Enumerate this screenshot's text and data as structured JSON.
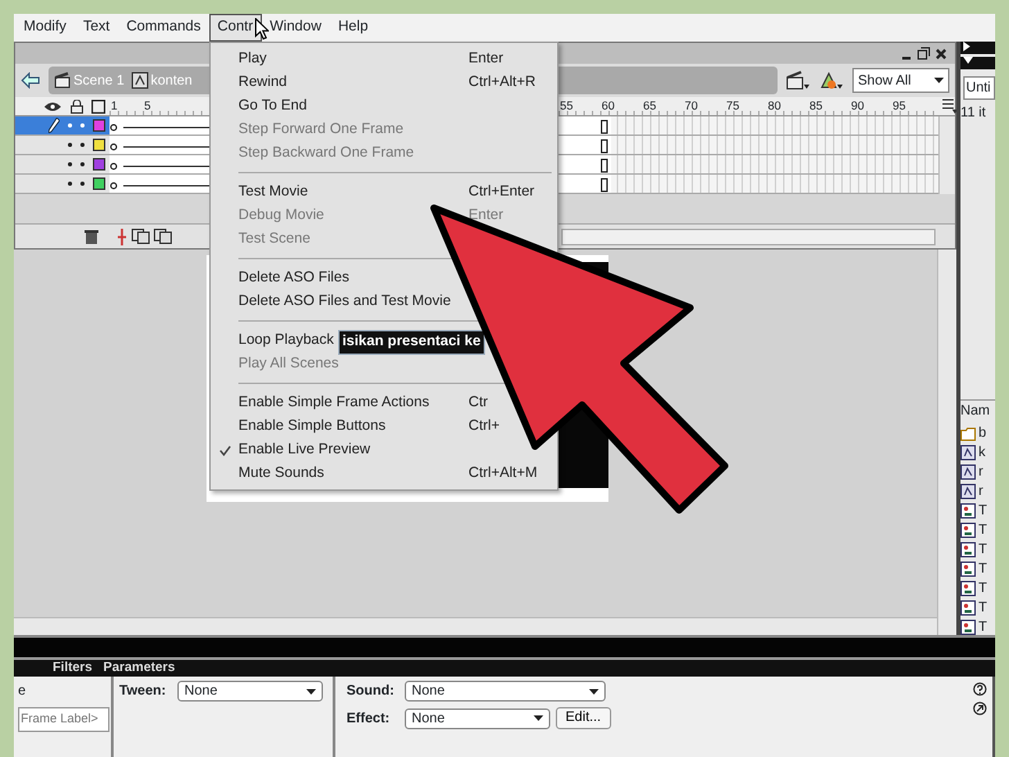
{
  "menubar": [
    {
      "label": "Modify",
      "selected": false
    },
    {
      "label": "Text",
      "selected": false
    },
    {
      "label": "Commands",
      "selected": false
    },
    {
      "label": "Contr",
      "selected": true
    },
    {
      "label": "Window",
      "selected": false
    },
    {
      "label": "Help",
      "selected": false
    }
  ],
  "control_menu": [
    {
      "kind": "item",
      "label": "Play",
      "shortcut": "Enter",
      "disabled": false,
      "checked": false
    },
    {
      "kind": "item",
      "label": "Rewind",
      "shortcut": "Ctrl+Alt+R",
      "disabled": false,
      "checked": false
    },
    {
      "kind": "item",
      "label": "Go To End",
      "disabled": false,
      "checked": false
    },
    {
      "kind": "item",
      "label": "Step Forward One Frame",
      "disabled": true,
      "checked": false
    },
    {
      "kind": "item",
      "label": "Step Backward One Frame",
      "disabled": true,
      "checked": false
    },
    {
      "kind": "separator"
    },
    {
      "kind": "item",
      "label": "Test Movie",
      "shortcut": "Ctrl+Enter",
      "disabled": false,
      "checked": false
    },
    {
      "kind": "item",
      "label": "Debug Movie",
      "shortcut": "Enter",
      "disabled": true,
      "checked": false
    },
    {
      "kind": "item",
      "label": "Test Scene",
      "disabled": true,
      "checked": false
    },
    {
      "kind": "separator"
    },
    {
      "kind": "item",
      "label": "Delete ASO Files",
      "disabled": false,
      "checked": false
    },
    {
      "kind": "item",
      "label": "Delete ASO Files and Test Movie",
      "disabled": false,
      "checked": false
    },
    {
      "kind": "separator"
    },
    {
      "kind": "item",
      "label": "Loop Playback",
      "disabled": false,
      "checked": false
    },
    {
      "kind": "item",
      "label": "Play All Scenes",
      "disabled": true,
      "checked": false
    },
    {
      "kind": "separator"
    },
    {
      "kind": "item",
      "label": "Enable Simple Frame Actions",
      "shortcut": "Ctr",
      "disabled": false,
      "checked": false
    },
    {
      "kind": "item",
      "label": "Enable Simple Buttons",
      "shortcut": "Ctrl+",
      "disabled": false,
      "checked": false
    },
    {
      "kind": "item",
      "label": "Enable Live Preview",
      "disabled": false,
      "checked": true
    },
    {
      "kind": "item",
      "label": "Mute Sounds",
      "shortcut": "Ctrl+Alt+M",
      "disabled": false,
      "checked": false
    }
  ],
  "timeline": {
    "crumbs": [
      {
        "kind": "scene",
        "label": "Scene 1"
      },
      {
        "kind": "symbol",
        "label": "konten"
      }
    ],
    "zoom": "Show All",
    "ruler_start": [
      "1",
      "5"
    ],
    "ruler_end": [
      "55",
      "60",
      "65",
      "70",
      "75",
      "80",
      "85",
      "90",
      "95"
    ],
    "layers": [
      {
        "color": "#e040e0",
        "selected": true
      },
      {
        "color": "#f0e040",
        "selected": false
      },
      {
        "color": "#a040e0",
        "selected": false
      },
      {
        "color": "#40d060",
        "selected": false
      }
    ]
  },
  "stage": {
    "text_field": "isikan presentaci ke"
  },
  "library": {
    "document": "Unti",
    "count": "11 it",
    "column": "Nam",
    "items": [
      {
        "kind": "folder",
        "label": "b"
      },
      {
        "kind": "symbol",
        "label": "k"
      },
      {
        "kind": "symbol",
        "label": "r"
      },
      {
        "kind": "symbol",
        "label": "r"
      },
      {
        "kind": "bitmap",
        "label": "T"
      },
      {
        "kind": "bitmap",
        "label": "T"
      },
      {
        "kind": "bitmap",
        "label": "T"
      },
      {
        "kind": "bitmap",
        "label": "T"
      },
      {
        "kind": "bitmap",
        "label": "T"
      },
      {
        "kind": "bitmap",
        "label": "T"
      },
      {
        "kind": "bitmap",
        "label": "T"
      }
    ]
  },
  "properties": {
    "tabs": [
      {
        "label": "Filters",
        "selected": false
      },
      {
        "label": "Parameters",
        "selected": false
      }
    ],
    "frame_heading": "e",
    "frame_label_placeholder": "Frame Label>",
    "tween": {
      "label": "Tween:",
      "value": "None"
    },
    "sound": {
      "label": "Sound:",
      "value": "None"
    },
    "effect": {
      "label": "Effect:",
      "value": "None"
    },
    "edit_button": "Edit..."
  }
}
